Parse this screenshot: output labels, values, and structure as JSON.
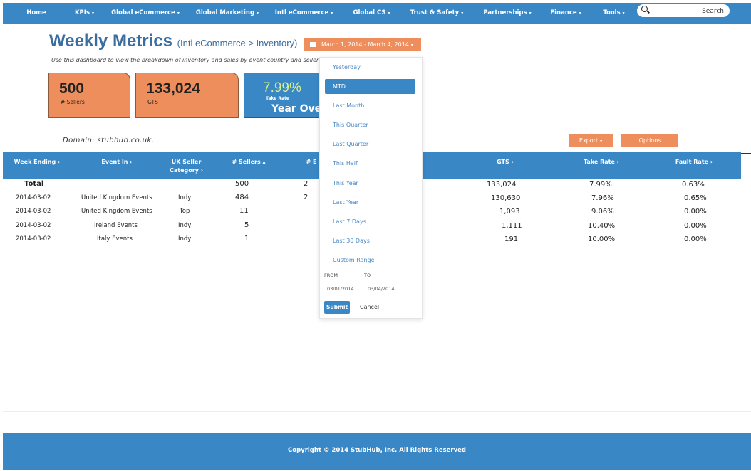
{
  "nav": {
    "items": [
      {
        "label": "Home",
        "caret": ""
      },
      {
        "label": "KPIs",
        "caret": "▾"
      },
      {
        "label": "Global eCommerce",
        "caret": "▾"
      },
      {
        "label": "Global Marketing",
        "caret": "▾"
      },
      {
        "label": "Intl eCommerce",
        "caret": "▾"
      },
      {
        "label": "Global CS",
        "caret": "▾"
      },
      {
        "label": "Trust & Safety",
        "caret": "▾"
      },
      {
        "label": "Partnerships",
        "caret": "▾"
      },
      {
        "label": "Finance",
        "caret": "▾"
      },
      {
        "label": "Tools",
        "caret": "▾"
      }
    ],
    "search_placeholder": "Search"
  },
  "header": {
    "title": "Weekly Metrics",
    "subtitle": "(Intl eCommerce > Inventory)",
    "description": "Use this dashboard to view the breakdown of inventory and sales by event country and seller type",
    "date_range": "March 1, 2014 - March 4, 2014"
  },
  "cards": [
    {
      "value": "500",
      "label": "# Sellers"
    },
    {
      "value": "133,024",
      "label": "GTS"
    },
    {
      "value": "7.99%",
      "label": "Take Rate",
      "big": "Year Over"
    }
  ],
  "domain_line": "Domain: stubhub.co.uk.",
  "buttons": {
    "export": "Export",
    "options": "Options"
  },
  "table": {
    "headers": [
      "Week Ending",
      "Event In",
      "UK Seller Category",
      "# Sellers",
      "# E",
      "GTS",
      "Take Rate",
      "Fault Rate"
    ],
    "total": {
      "label": "Total",
      "sellers": "500",
      "e": "2",
      "gts": "133,024",
      "take_rate": "7.99%",
      "fault_rate": "0.63%"
    },
    "rows": [
      {
        "week": "2014-03-02",
        "event": "United Kingdom Events",
        "cat": "Indy",
        "sellers": "484",
        "e": "2",
        "gts": "130,630",
        "take_rate": "7.96%",
        "fault_rate": "0.65%"
      },
      {
        "week": "2014-03-02",
        "event": "United Kingdom Events",
        "cat": "Top",
        "sellers": "11",
        "e": "",
        "gts": "1,093",
        "take_rate": "9.06%",
        "fault_rate": "0.00%"
      },
      {
        "week": "2014-03-02",
        "event": "Ireland Events",
        "cat": "Indy",
        "sellers": "5",
        "e": "",
        "gts": "1,111",
        "take_rate": "10.40%",
        "fault_rate": "0.00%"
      },
      {
        "week": "2014-03-02",
        "event": "Italy Events",
        "cat": "Indy",
        "sellers": "1",
        "e": "",
        "gts": "191",
        "take_rate": "10.00%",
        "fault_rate": "0.00%"
      }
    ]
  },
  "dropdown": {
    "items": [
      "Yesterday",
      "MTD",
      "Last Month",
      "This Quarter",
      "Last Quarter",
      "This Half",
      "This Year",
      "Last Year",
      "Last 7 Days",
      "Last 30 Days",
      "Custom Range"
    ],
    "active": "MTD",
    "from_label": "FROM",
    "to_label": "TO",
    "from_value": "03/01/2014",
    "to_value": "03/04/2014",
    "submit": "Submit",
    "cancel": "Cancel"
  },
  "footer": "Copyright © 2014 StubHub, Inc. All Rights Reserved",
  "colors": {
    "nav_blue": "#3a87c6",
    "orange": "#ee8e5c",
    "title_blue": "#3b6da0",
    "green_value": "#d6ef8a"
  }
}
